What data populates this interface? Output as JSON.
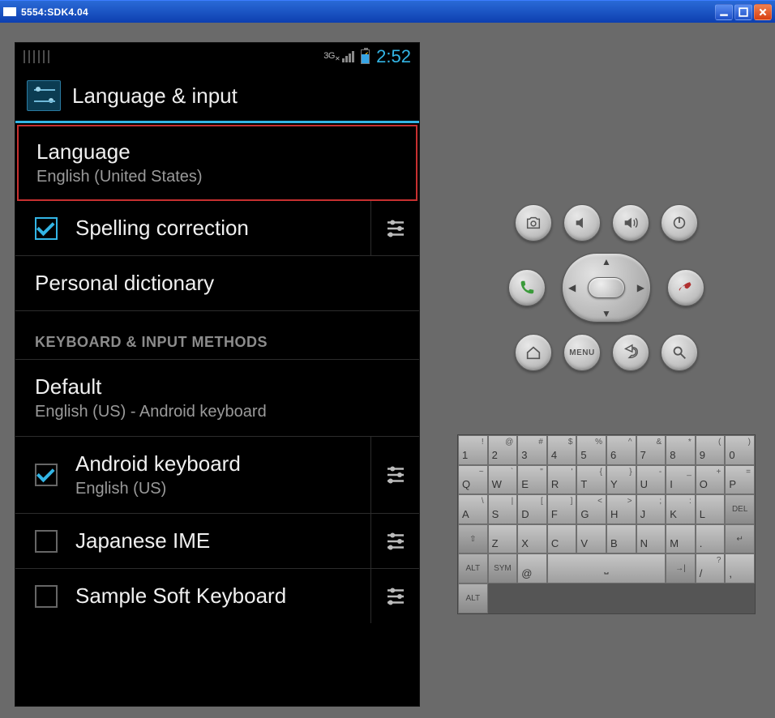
{
  "window": {
    "title": "5554:SDK4.04"
  },
  "statusbar": {
    "net_label": "3G",
    "time": "2:52"
  },
  "header": {
    "title": "Language & input"
  },
  "items": {
    "language": {
      "title": "Language",
      "sub": "English (United States)"
    },
    "spelling": {
      "title": "Spelling correction"
    },
    "personal_dict": {
      "title": "Personal dictionary"
    },
    "section_kbd": "KEYBOARD & INPUT METHODS",
    "default": {
      "title": "Default",
      "sub": "English (US) - Android keyboard"
    },
    "android_kbd": {
      "title": "Android keyboard",
      "sub": "English (US)"
    },
    "jp_ime": {
      "title": "Japanese IME"
    },
    "sample_kbd": {
      "title": "Sample Soft Keyboard"
    }
  },
  "side_buttons": {
    "menu_label": "MENU"
  },
  "keyboard": {
    "row1": [
      {
        "m": "1",
        "a": "!"
      },
      {
        "m": "2",
        "a": "@"
      },
      {
        "m": "3",
        "a": "#"
      },
      {
        "m": "4",
        "a": "$"
      },
      {
        "m": "5",
        "a": "%"
      },
      {
        "m": "6",
        "a": "^"
      },
      {
        "m": "7",
        "a": "&"
      },
      {
        "m": "8",
        "a": "*"
      },
      {
        "m": "9",
        "a": "("
      },
      {
        "m": "0",
        "a": ")"
      }
    ],
    "row2": [
      {
        "m": "Q",
        "a": "~"
      },
      {
        "m": "W",
        "a": "`"
      },
      {
        "m": "E",
        "a": "\""
      },
      {
        "m": "R",
        "a": "'"
      },
      {
        "m": "T",
        "a": "{"
      },
      {
        "m": "Y",
        "a": "}"
      },
      {
        "m": "U",
        "a": "-"
      },
      {
        "m": "I",
        "a": "_"
      },
      {
        "m": "O",
        "a": "+"
      },
      {
        "m": "P",
        "a": "="
      }
    ],
    "row3": [
      {
        "m": "A",
        "a": "\\"
      },
      {
        "m": "S",
        "a": "|"
      },
      {
        "m": "D",
        "a": "["
      },
      {
        "m": "F",
        "a": "]"
      },
      {
        "m": "G",
        "a": "<"
      },
      {
        "m": "H",
        "a": ">"
      },
      {
        "m": "J",
        "a": ";"
      },
      {
        "m": "K",
        "a": ":"
      },
      {
        "m": "L",
        "a": ""
      },
      {
        "m": "DEL",
        "fn": true
      }
    ],
    "row4": [
      {
        "m": "⇧",
        "fn": true
      },
      {
        "m": "Z"
      },
      {
        "m": "X"
      },
      {
        "m": "C"
      },
      {
        "m": "V"
      },
      {
        "m": "B"
      },
      {
        "m": "N"
      },
      {
        "m": "M"
      },
      {
        "m": "."
      },
      {
        "m": "↵",
        "fn": true
      }
    ],
    "row5": [
      {
        "m": "ALT",
        "fn": true
      },
      {
        "m": "SYM",
        "fn": true
      },
      {
        "m": "@"
      },
      {
        "m": "⎵",
        "space": true
      },
      {
        "m": "→|",
        "fn": true
      },
      {
        "m": "/",
        "a": "?"
      },
      {
        "m": ",",
        "a": ""
      },
      {
        "m": "ALT",
        "fn": true
      }
    ]
  }
}
